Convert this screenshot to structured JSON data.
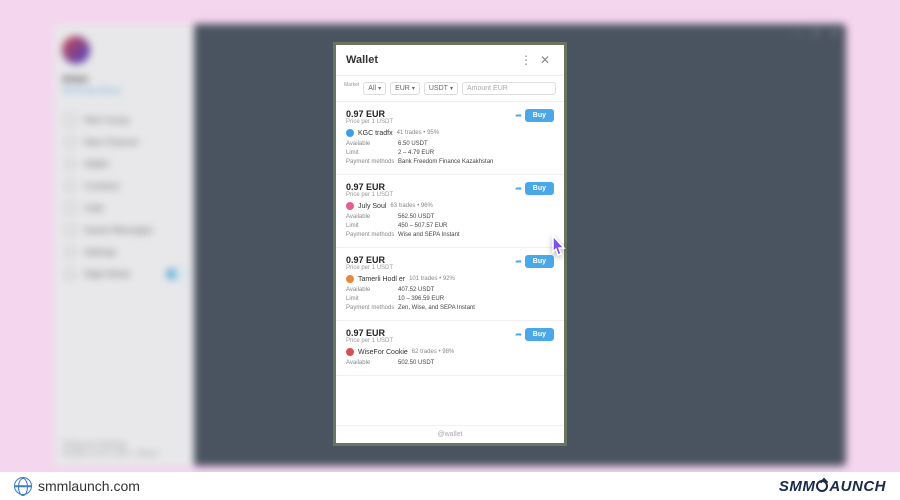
{
  "sidebar": {
    "user": "Artem",
    "status": "Set Emoji Status",
    "items": [
      "New Group",
      "New Channel",
      "Wallet",
      "Contacts",
      "Calls",
      "Saved Messages",
      "Settings",
      "Night Mode"
    ],
    "footer1": "Telegram Desktop",
    "footer2": "Version 4.10.3 x64 – About"
  },
  "wallet": {
    "title": "Wallet",
    "filters": {
      "market": "All",
      "fiat": "EUR",
      "crypto": "USDT",
      "amount": "Amount EUR"
    },
    "offers": [
      {
        "price": "0.97 EUR",
        "sub": "Price per 1 USDT",
        "dot": "#39a0e8",
        "trader": "KGC tradfx",
        "stats": "41 trades • 95%",
        "available": "6.50 USDT",
        "limit": "2 – 4.79 EUR",
        "methods": "Bank Freedom Finance Kazakhstan",
        "buy": "Buy"
      },
      {
        "price": "0.97 EUR",
        "sub": "Price per 1 USDT",
        "dot": "#e85a9a",
        "trader": "July Soul",
        "stats": "63 trades • 96%",
        "available": "562.50 USDT",
        "limit": "450 – 507.57 EUR",
        "methods": "Wise and SEPA Instant",
        "buy": "Buy"
      },
      {
        "price": "0.97 EUR",
        "sub": "Price per 1 USDT",
        "dot": "#e8893a",
        "trader": "Tamerli Hodl er",
        "stats": "101 trades • 92%",
        "available": "407.52 USDT",
        "limit": "10 – 396.59 EUR",
        "methods": "Zen, Wise, and SEPA Instant",
        "buy": "Buy"
      },
      {
        "price": "0.97 EUR",
        "sub": "Price per 1 USDT",
        "dot": "#d85050",
        "trader": "WiseFor Cookie",
        "stats": "62 trades • 98%",
        "available": "502.50 USDT",
        "limit": "",
        "methods": "",
        "buy": "Buy"
      }
    ],
    "handle": "@wallet",
    "labels": {
      "available": "Available",
      "limit": "Limit",
      "methods": "Payment methods"
    }
  },
  "footer": {
    "site": "smmlaunch.com",
    "brand_pre": "SMM",
    "brand_post": "AUNCH"
  }
}
